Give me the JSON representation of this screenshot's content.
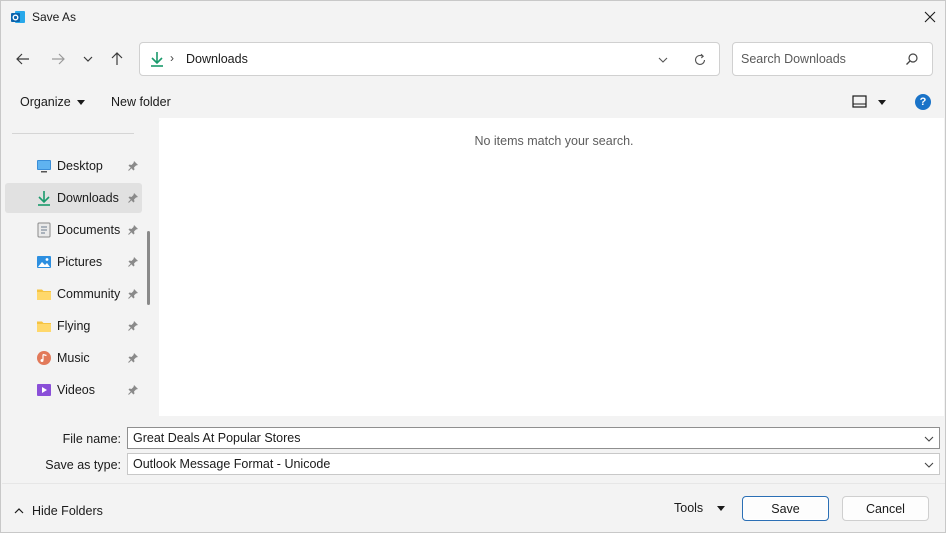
{
  "window": {
    "title": "Save As",
    "app_icon": "outlook-icon",
    "close_icon": "close-icon"
  },
  "nav": {
    "back_icon": "arrow-left-icon",
    "forward_icon": "arrow-right-icon",
    "recent_icon": "chevron-down-icon",
    "up_icon": "arrow-up-icon"
  },
  "address": {
    "location_icon": "download-icon",
    "separator": "›",
    "path": "Downloads"
  },
  "search": {
    "placeholder": "Search Downloads"
  },
  "toolbar": {
    "organize_label": "Organize",
    "new_folder_label": "New folder",
    "help_label": "?"
  },
  "sidebar": {
    "items": [
      {
        "label": "Desktop",
        "icon": "desktop-icon",
        "pinned": true,
        "selected": false
      },
      {
        "label": "Downloads",
        "icon": "download-icon",
        "pinned": true,
        "selected": true
      },
      {
        "label": "Documents",
        "icon": "documents-icon",
        "pinned": true,
        "selected": false
      },
      {
        "label": "Pictures",
        "icon": "pictures-icon",
        "pinned": true,
        "selected": false
      },
      {
        "label": "Community",
        "icon": "folder-icon",
        "pinned": true,
        "selected": false
      },
      {
        "label": "Flying",
        "icon": "folder-icon",
        "pinned": true,
        "selected": false
      },
      {
        "label": "Music",
        "icon": "music-icon",
        "pinned": true,
        "selected": false
      },
      {
        "label": "Videos",
        "icon": "videos-icon",
        "pinned": true,
        "selected": false
      }
    ]
  },
  "content": {
    "empty_message": "No items match your search."
  },
  "fields": {
    "file_name_label": "File name:",
    "file_name_value": "Great Deals At Popular Stores",
    "save_type_label": "Save as type:",
    "save_type_value": "Outlook Message Format - Unicode"
  },
  "footer": {
    "hide_folders_label": "Hide Folders",
    "tools_label": "Tools",
    "save_label": "Save",
    "cancel_label": "Cancel"
  },
  "colors": {
    "accent": "#1a73c8",
    "download_green": "#1a9a6c",
    "folder_yellow": "#f5c342"
  }
}
